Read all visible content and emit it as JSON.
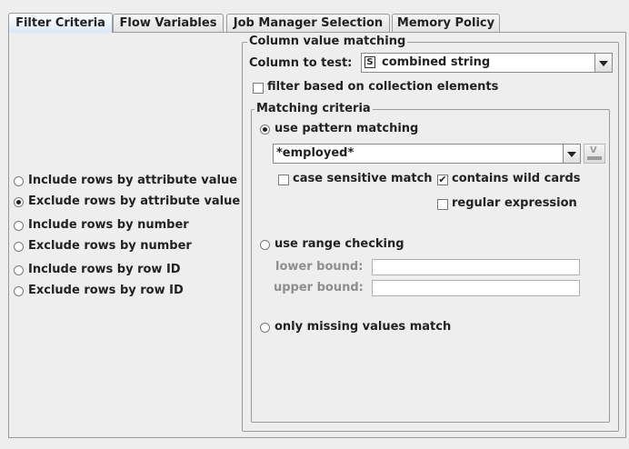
{
  "tabs": [
    "Filter Criteria",
    "Flow Variables",
    "Job Manager Selection",
    "Memory Policy"
  ],
  "left_options": [
    {
      "label": "Include rows by attribute value",
      "selected": false
    },
    {
      "label": "Exclude rows by attribute value",
      "selected": true
    },
    {
      "label": "Include rows by number",
      "selected": false
    },
    {
      "label": "Exclude rows by number",
      "selected": false
    },
    {
      "label": "Include rows by row ID",
      "selected": false
    },
    {
      "label": "Exclude rows by row ID",
      "selected": false
    }
  ],
  "column_matching": {
    "title": "Column value matching",
    "column_label": "Column to test:",
    "column_type_badge": "S",
    "column_value": "combined string",
    "collection_label": "filter based on collection elements",
    "collection_checked": false
  },
  "criteria": {
    "title": "Matching criteria",
    "pattern_label": "use pattern matching",
    "pattern_selected": true,
    "pattern_value": "*employed*",
    "case_label": "case sensitive match",
    "case_checked": false,
    "wild_label": "contains wild cards",
    "wild_checked": true,
    "regex_label": "regular expression",
    "regex_checked": false,
    "range_label": "use range checking",
    "range_selected": false,
    "lower_label": "lower bound:",
    "lower_value": "",
    "upper_label": "upper bound:",
    "upper_value": "",
    "missing_label": "only missing values match",
    "missing_selected": false,
    "variable_button_icon": "flow-variable-icon"
  }
}
